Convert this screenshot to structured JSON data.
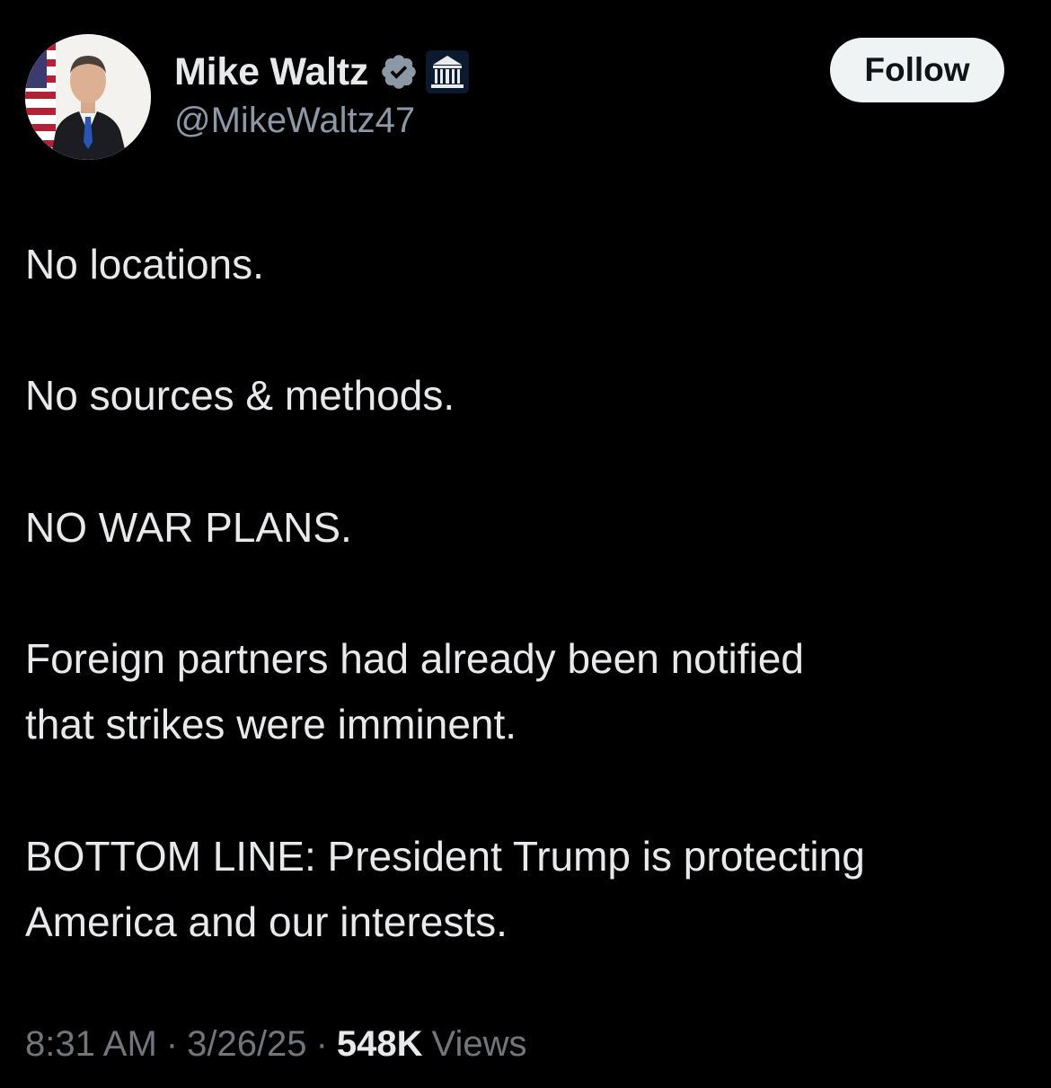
{
  "header": {
    "display_name": "Mike Waltz",
    "handle": "@MikeWaltz47",
    "follow_label": "Follow",
    "verified_icon": "verified-badge-icon",
    "affiliation_icon": "white-house-icon",
    "colors": {
      "verified": "#8b98a5",
      "follow_bg": "#eff3f4"
    }
  },
  "tweet": {
    "paragraphs": [
      [
        "No locations."
      ],
      [
        "No sources & methods."
      ],
      [
        "NO WAR PLANS."
      ],
      [
        "Foreign partners had already been notified",
        "that strikes were imminent."
      ],
      [
        "BOTTOM LINE:  President Trump is protecting",
        "America and our interests."
      ]
    ]
  },
  "footer": {
    "time": "8:31 AM",
    "date": "3/26/25",
    "views_count": "548K",
    "views_label": "Views",
    "separator": "·"
  }
}
